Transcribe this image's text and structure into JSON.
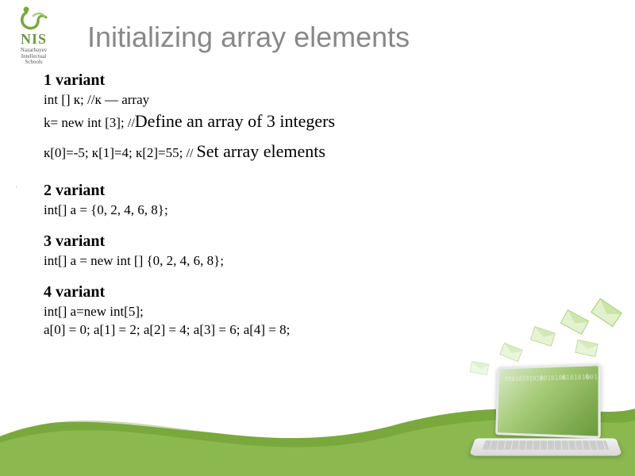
{
  "logo": {
    "acronym": "NIS",
    "line1": "Nazarbayev",
    "line2": "Intellectual",
    "line3": "Schools"
  },
  "title": "Initializing array elements",
  "variants": {
    "v1": {
      "head": "1 variant",
      "l1a": "int [] к; //к — array",
      "l2a": "k= new int [3];  ",
      "l2b": "//",
      "l2c": "Define an array of 3 integers",
      "l3a": "к[0]=-5; к[1]=4; к[2]=55;  ",
      "l3b": "// ",
      "l3c": " Set array elements"
    },
    "v2": {
      "head": "2 variant",
      "l1": "int[] a = {0, 2, 4, 6, 8};"
    },
    "v3": {
      "head": "3 variant",
      "l1": "int[] a = new int [] {0, 2, 4, 6, 8};"
    },
    "v4": {
      "head": "4 variant",
      "l1": "int[] a=new int[5];",
      "l2": "a[0] = 0; a[1] = 2; a[2] = 4; a[3] = 6; a[4] = 8;"
    }
  }
}
